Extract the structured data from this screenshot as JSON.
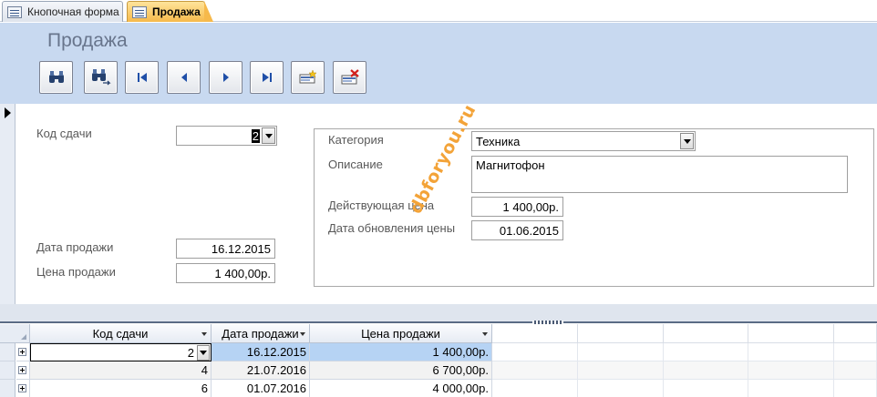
{
  "tabs": [
    {
      "label": "Кнопочная форма",
      "active": false
    },
    {
      "label": "Продажа",
      "active": true
    }
  ],
  "form": {
    "title": "Продажа",
    "nav_buttons": [
      {
        "icon": "binoculars-icon"
      },
      {
        "icon": "binoculars-next-icon"
      },
      {
        "icon": "first-record-icon"
      },
      {
        "icon": "previous-record-icon"
      },
      {
        "icon": "next-record-icon"
      },
      {
        "icon": "last-record-icon"
      },
      {
        "icon": "new-record-icon"
      },
      {
        "icon": "delete-record-icon"
      }
    ]
  },
  "detail": {
    "kod_sdachi_label": "Код сдачи",
    "kod_sdachi_value": "2",
    "data_prodazhi_label": "Дата продажи",
    "data_prodazhi_value": "16.12.2015",
    "cena_prodazhi_label": "Цена продажи",
    "cena_prodazhi_value": "1 400,00р.",
    "kategoriya_label": "Категория",
    "kategoriya_value": "Техника",
    "opisanie_label": "Описание",
    "opisanie_value": "Магнитофон",
    "deistv_cena_label": "Действующая цена",
    "deistv_cena_value": "1 400,00р.",
    "data_obnovleniya_label": "Дата обновления цены",
    "data_obnovleniya_value": "01.06.2015"
  },
  "watermark": "dbforyou.ru",
  "datasheet": {
    "columns": [
      "Код сдачи",
      "Дата продажи",
      "Цена продажи"
    ],
    "rows": [
      {
        "kod": "2",
        "date": "16.12.2015",
        "price": "1 400,00р."
      },
      {
        "kod": "4",
        "date": "21.07.2016",
        "price": "6 700,00р."
      },
      {
        "kod": "6",
        "date": "01.07.2016",
        "price": "4 000,00р."
      }
    ]
  },
  "colors": {
    "header_bg": "#c8d9f0",
    "active_tab": "#f6b94b",
    "title_text": "#68758c",
    "watermark": "#f3a338",
    "row_highlight": "#b6d3f4"
  }
}
